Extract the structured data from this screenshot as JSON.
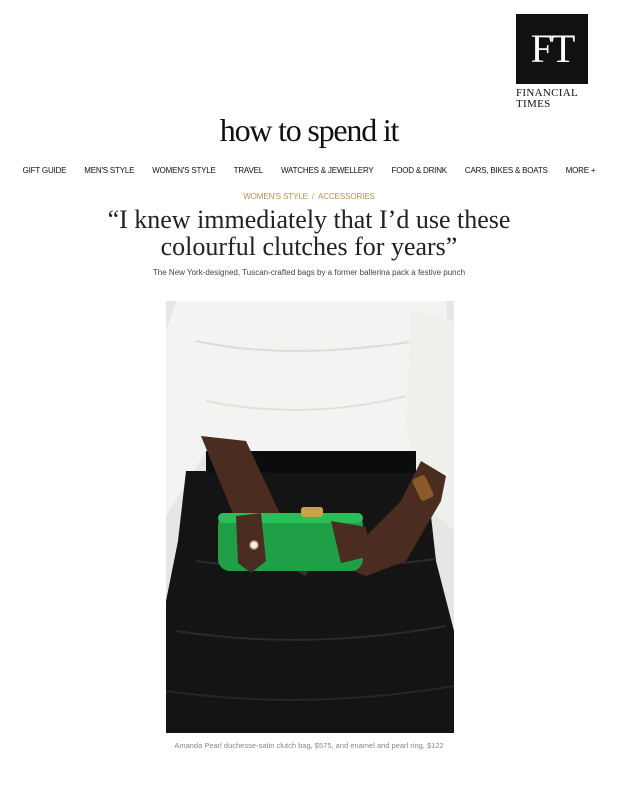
{
  "brand": {
    "logo_mark": "FT",
    "name_line1": "FINANCIAL",
    "name_line2": "TIMES"
  },
  "masthead": "how to spend it",
  "nav": {
    "items": [
      {
        "label": "GIFT GUIDE"
      },
      {
        "label": "MEN'S STYLE"
      },
      {
        "label": "WOMEN'S STYLE"
      },
      {
        "label": "TRAVEL"
      },
      {
        "label": "WATCHES & JEWELLERY"
      },
      {
        "label": "FOOD & DRINK"
      },
      {
        "label": "CARS, BIKES & BOATS"
      },
      {
        "label": "MORE +"
      }
    ]
  },
  "article": {
    "breadcrumb": {
      "section": "WOMEN'S STYLE",
      "separator": "/",
      "subsection": "ACCESSORIES"
    },
    "headline_line1": "“I knew immediately that I’d use these",
    "headline_line2": "colourful clutches for years”",
    "standfirst": "The New York-designed, Tuscan-crafted bags by a former ballerina pack a festive punch",
    "image_caption": "Amanda Pearl duchesse-satin clutch bag, $575, and enamel and pearl ring, $122"
  },
  "colors": {
    "accent_gold": "#b09152",
    "clutch_green": "#1fa046"
  }
}
